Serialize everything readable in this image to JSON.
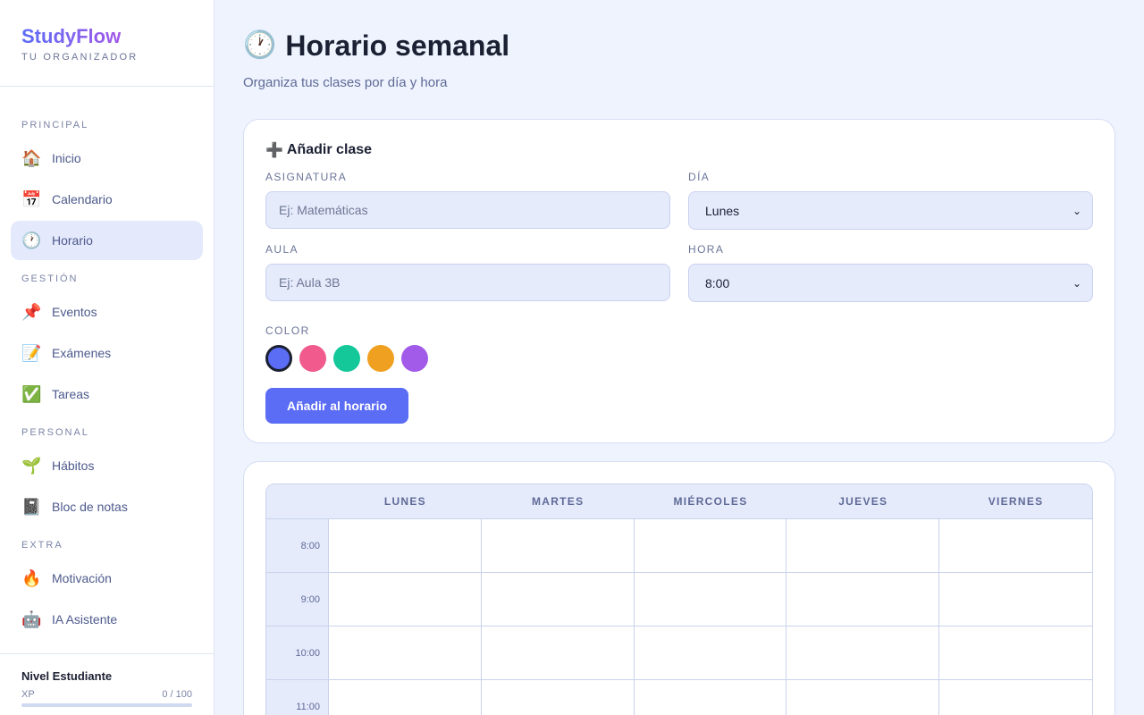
{
  "brand": {
    "name": "StudyFlow",
    "subtitle": "TU ORGANIZADOR"
  },
  "sidebar": {
    "sections": [
      {
        "label": "PRINCIPAL",
        "items": [
          {
            "icon": "house-icon",
            "glyph": "🏠",
            "label": "Inicio"
          },
          {
            "icon": "calendar-icon",
            "glyph": "📅",
            "label": "Calendario"
          },
          {
            "icon": "clock-icon",
            "glyph": "🕐",
            "label": "Horario",
            "active": true
          }
        ]
      },
      {
        "label": "GESTIÓN",
        "items": [
          {
            "icon": "pushpin-icon",
            "glyph": "📌",
            "label": "Eventos"
          },
          {
            "icon": "memo-icon",
            "glyph": "📝",
            "label": "Exámenes"
          },
          {
            "icon": "check-mark-icon",
            "glyph": "✅",
            "label": "Tareas"
          }
        ]
      },
      {
        "label": "PERSONAL",
        "items": [
          {
            "icon": "seedling-icon",
            "glyph": "🌱",
            "label": "Hábitos"
          },
          {
            "icon": "notebook-icon",
            "glyph": "📓",
            "label": "Bloc de notas"
          }
        ]
      },
      {
        "label": "EXTRA",
        "items": [
          {
            "icon": "fire-icon",
            "glyph": "🔥",
            "label": "Motivación"
          },
          {
            "icon": "robot-icon",
            "glyph": "🤖",
            "label": "IA Asistente"
          }
        ]
      }
    ],
    "level": {
      "title": "Nivel Estudiante",
      "xp_label": "XP",
      "xp_text": "0 / 100",
      "xp_progress": 0
    }
  },
  "header": {
    "icon": "clock-icon",
    "glyph": "🕐",
    "title": "Horario semanal",
    "subtitle": "Organiza tus clases por día y hora"
  },
  "form": {
    "icon": "plus-icon",
    "glyph": "➕",
    "title": "Añadir clase",
    "subject_label": "ASIGNATURA",
    "subject_placeholder": "Ej: Matemáticas",
    "subject_value": "",
    "day_label": "DÍA",
    "day_value": "Lunes",
    "room_label": "AULA",
    "room_placeholder": "Ej: Aula 3B",
    "room_value": "",
    "hour_label": "HORA",
    "hour_value": "8:00",
    "color_label": "COLOR",
    "colors": [
      "#5b6cf5",
      "#f05a8c",
      "#14c89a",
      "#f0a020",
      "#a25ae8"
    ],
    "selected_color": "#5b6cf5",
    "submit_label": "Añadir al horario"
  },
  "schedule": {
    "days": [
      "LUNES",
      "MARTES",
      "MIÉRCOLES",
      "JUEVES",
      "VIERNES"
    ],
    "hours": [
      "8:00",
      "9:00",
      "10:00",
      "11:00"
    ]
  },
  "colors": {
    "accent": "#5b6cf5",
    "brand_gradient_end": "#a25ae8",
    "background": "#eef3fe"
  }
}
